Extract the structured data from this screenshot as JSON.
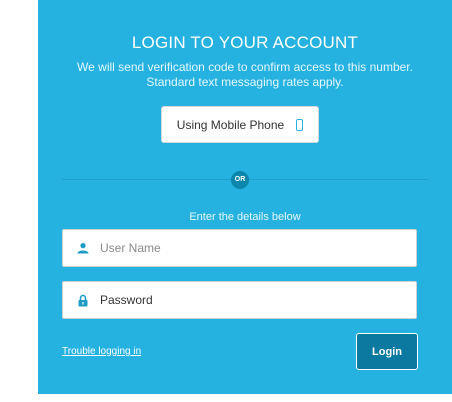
{
  "header": {
    "title": "LOGIN TO YOUR ACCOUNT",
    "subtitle": "We will send verification code to confirm access to this number. Standard text messaging rates apply."
  },
  "mobile_option": {
    "label": "Using Mobile Phone",
    "icon": "mobile-phone-icon"
  },
  "divider": {
    "label": "OR"
  },
  "form": {
    "instruction": "Enter the details below",
    "username": {
      "placeholder": "User Name",
      "value": "",
      "icon": "user-icon"
    },
    "password": {
      "placeholder": "Password",
      "value": "",
      "icon": "lock-icon"
    }
  },
  "footer": {
    "trouble_link": "Trouble logging in",
    "login_button": "Login"
  },
  "colors": {
    "panel_background": "#26b2e0",
    "accent_dark": "#0c7aa0",
    "icon_color": "#1d9cc6"
  }
}
